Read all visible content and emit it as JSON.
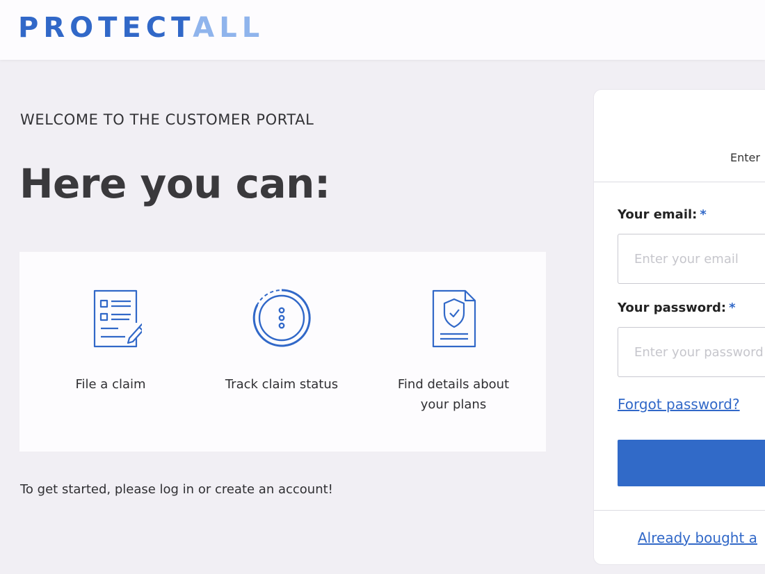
{
  "brand": {
    "logo_part1": "PROTECT",
    "logo_part2": "ALL",
    "primary_color": "#3168c8",
    "secondary_color": "#8fb4ec"
  },
  "intro": {
    "welcome": "WELCOME TO THE CUSTOMER PORTAL",
    "headline": "Here you can:",
    "get_started": "To get started, please log in or create an account!"
  },
  "features": [
    {
      "label": "File a claim",
      "icon": "claim-form-icon"
    },
    {
      "label": "Track claim status",
      "icon": "status-tracker-icon"
    },
    {
      "label_line1": "Find details about",
      "label_line2": "your plans",
      "icon": "plan-shield-document-icon"
    }
  ],
  "login": {
    "subtitle_partial": "Enter",
    "email_label": "Your email:",
    "email_placeholder": "Enter your email",
    "password_label": "Your password:",
    "password_placeholder": "Enter your password",
    "required_marker": "*",
    "forgot_link": "Forgot password?",
    "already_bought_link": "Already bought a"
  }
}
